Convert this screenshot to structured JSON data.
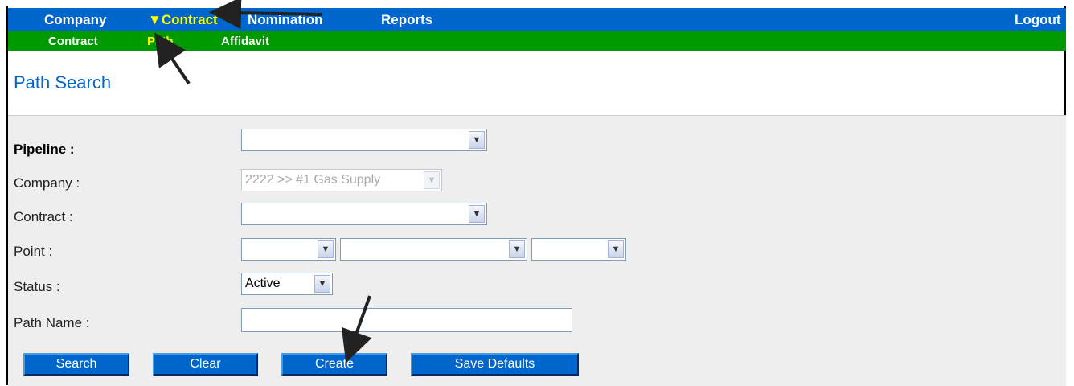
{
  "topnav": {
    "company": "Company",
    "contract": "▼Contract",
    "nomination": "Nomination",
    "reports": "Reports",
    "logout": "Logout"
  },
  "subnav": {
    "contract": "Contract",
    "path": "Path",
    "affidavit": "Affidavit"
  },
  "page": {
    "title": "Path Search"
  },
  "form": {
    "pipeline_label": "Pipeline :",
    "pipeline_value": "",
    "company_label": "Company :",
    "company_value": "2222 >> #1 Gas Supply",
    "contract_label": "Contract :",
    "contract_value": "",
    "point_label": "Point :",
    "point_values": [
      "",
      "",
      ""
    ],
    "status_label": "Status :",
    "status_value": "Active",
    "path_name_label": "Path Name :",
    "path_name_value": ""
  },
  "buttons": {
    "search": "Search",
    "clear": "Clear",
    "create": "Create",
    "save_defaults": "Save Defaults"
  },
  "colors": {
    "topnav_bg": "#0066cc",
    "subnav_bg": "#009900",
    "active_nav": "#ffff00",
    "title": "#0066cc",
    "button_bg": "#0066cc"
  }
}
